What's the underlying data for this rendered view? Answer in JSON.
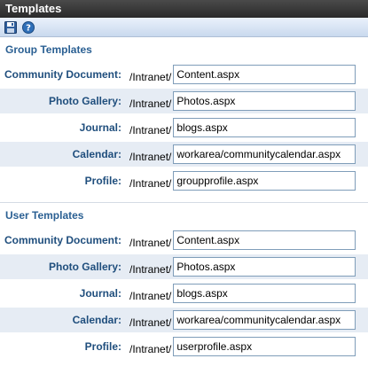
{
  "window": {
    "title": "Templates"
  },
  "toolbar": {
    "save_icon": "save-icon",
    "help_icon": "help-icon"
  },
  "prefix": "/Intranet/",
  "group": {
    "title": "Group Templates",
    "rows": [
      {
        "label": "Community Document:",
        "value": "Content.aspx"
      },
      {
        "label": "Photo Gallery:",
        "value": "Photos.aspx"
      },
      {
        "label": "Journal:",
        "value": "blogs.aspx"
      },
      {
        "label": "Calendar:",
        "value": "workarea/communitycalendar.aspx"
      },
      {
        "label": "Profile:",
        "value": "groupprofile.aspx"
      }
    ]
  },
  "user": {
    "title": "User Templates",
    "rows": [
      {
        "label": "Community Document:",
        "value": "Content.aspx"
      },
      {
        "label": "Photo Gallery:",
        "value": "Photos.aspx"
      },
      {
        "label": "Journal:",
        "value": "blogs.aspx"
      },
      {
        "label": "Calendar:",
        "value": "workarea/communitycalendar.aspx"
      },
      {
        "label": "Profile:",
        "value": "userprofile.aspx"
      }
    ]
  }
}
